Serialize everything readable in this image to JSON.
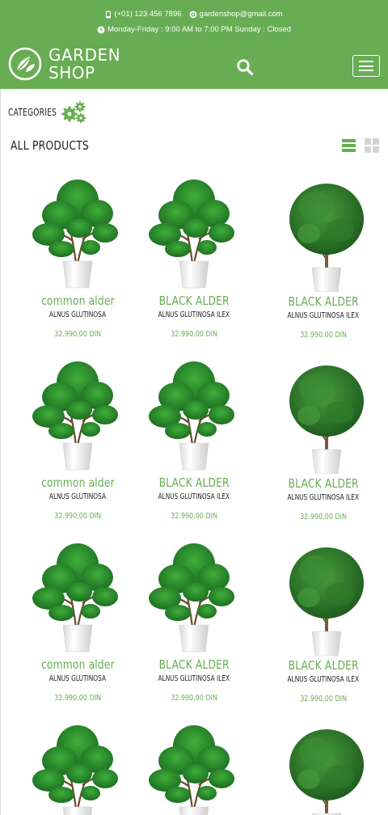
{
  "header": {
    "phone": "(+01) 123 456 7896",
    "email": "gardenshop@gmail.com",
    "hours": "Monday-Friday : 9:00 AM to 7:00 PM Sunday : Closed",
    "logo_line1": "GARDEN",
    "logo_line2": "SHOP",
    "icons": {
      "phone": "phone-icon",
      "email": "at-icon",
      "clock": "clock-icon",
      "search": "search-icon",
      "menu": "hamburger-menu-icon",
      "logo": "leaf-logo-icon"
    }
  },
  "categories": {
    "label": "CATEGORIES",
    "icon": "gears-icon"
  },
  "products_section": {
    "title": "ALL PRODUCTS",
    "view_icons": [
      "list-view-icon",
      "grid-view-icon"
    ]
  },
  "products": [
    {
      "name": "common alder",
      "latin": "ALNUS GLUTINOSA",
      "price": "32.990,00 DIN",
      "kind": "pine"
    },
    {
      "name": "BLACK ALDER",
      "latin": "ALNUS GLUTINOSA ILEX",
      "price": "32.990,00 DIN",
      "kind": "pine"
    },
    {
      "name": "BLACK ALDER",
      "latin": "ALNUS GLUTINOSA ILEX",
      "price": "32.990,00 DIN",
      "kind": "bush"
    },
    {
      "name": "common alder",
      "latin": "ALNUS GLUTINOSA",
      "price": "32.990,00 DIN",
      "kind": "pine"
    },
    {
      "name": "BLACK ALDER",
      "latin": "ALNUS GLUTINOSA ILEX",
      "price": "32.990,00 DIN",
      "kind": "pine"
    },
    {
      "name": "BLACK ALDER",
      "latin": "ALNUS GLUTINOSA ILEX",
      "price": "32.990,00 DIN",
      "kind": "bush"
    },
    {
      "name": "common alder",
      "latin": "ALNUS GLUTINOSA",
      "price": "32.990,00 DIN",
      "kind": "pine"
    },
    {
      "name": "BLACK ALDER",
      "latin": "ALNUS GLUTINOSA ILEX",
      "price": "32.990,00 DIN",
      "kind": "pine"
    },
    {
      "name": "BLACK ALDER",
      "latin": "ALNUS GLUTINOSA ILEX",
      "price": "32.990,00 DIN",
      "kind": "bush"
    },
    {
      "name": "",
      "latin": "",
      "price": "",
      "kind": "pine"
    },
    {
      "name": "",
      "latin": "",
      "price": "",
      "kind": "pine"
    },
    {
      "name": "",
      "latin": "",
      "price": "",
      "kind": "bush"
    }
  ],
  "colors": {
    "brand_green": "#68ad53",
    "text_dark": "#222222",
    "muted_gray": "#d3d3d3"
  }
}
